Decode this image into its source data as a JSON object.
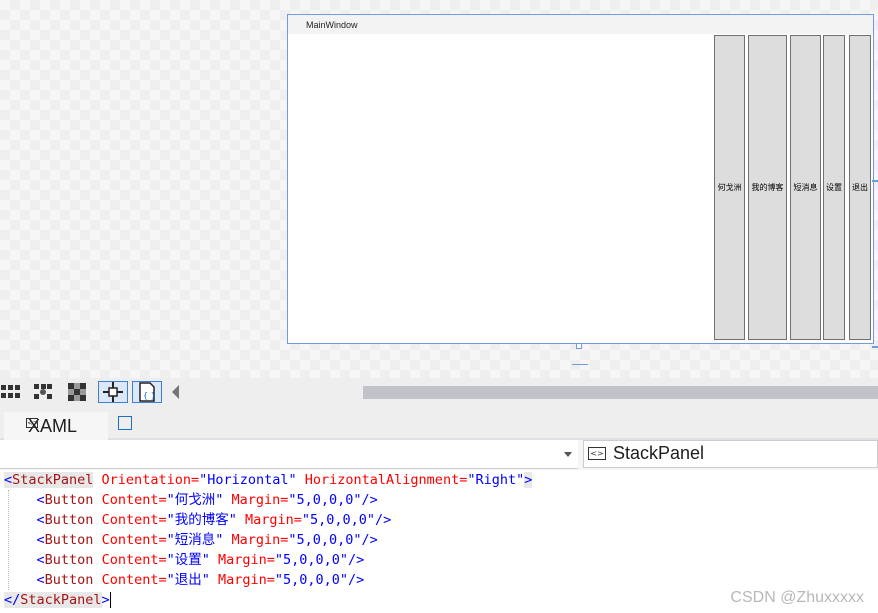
{
  "designer": {
    "window_title": "MainWindow",
    "buttons": [
      "何戈洲",
      "我的博客",
      "短消息",
      "设置",
      "退出"
    ]
  },
  "toolbar": {
    "icons": [
      "grid-icon",
      "snap-grid-icon",
      "checker-icon",
      "snap-lines-icon",
      "code-behind-icon"
    ]
  },
  "tabs": {
    "xaml_label": "XAML"
  },
  "nav": {
    "element_label": "StackPanel"
  },
  "code": {
    "line1": {
      "open": "<",
      "tag": "StackPanel",
      "attr1": " Orientation=",
      "val1": "\"Horizontal\"",
      "attr2": " HorizontalAlignment=",
      "val2": "\"Right\"",
      "close": ">"
    },
    "button_lines": [
      {
        "tag": "Button",
        "content_attr": " Content=",
        "content_val": "\"何戈洲\"",
        "margin_attr": " Margin=",
        "margin_val": "\"5,0,0,0\"",
        "close": "/>"
      },
      {
        "tag": "Button",
        "content_attr": " Content=",
        "content_val": "\"我的博客\"",
        "margin_attr": " Margin=",
        "margin_val": "\"5,0,0,0\"",
        "close": "/>"
      },
      {
        "tag": "Button",
        "content_attr": " Content=",
        "content_val": "\"短消息\"",
        "margin_attr": " Margin=",
        "margin_val": "\"5,0,0,0\"",
        "close": "/>"
      },
      {
        "tag": "Button",
        "content_attr": " Content=",
        "content_val": "\"设置\"",
        "margin_attr": " Margin=",
        "margin_val": "\"5,0,0,0\"",
        "close": "/>"
      },
      {
        "tag": "Button",
        "content_attr": " Content=",
        "content_val": "\"退出\"",
        "margin_attr": " Margin=",
        "margin_val": "\"5,0,0,0\"",
        "close": "/>"
      }
    ],
    "last_line": {
      "open": "</",
      "tag": "StackPanel",
      "close": ">"
    }
  },
  "watermark": "CSDN @Zhuxxxxx",
  "colors": {
    "selection_blue": "#6f9ce0",
    "xml_tag": "#a31515",
    "xml_attr": "#ff0000",
    "xml_value": "#0000ff"
  }
}
